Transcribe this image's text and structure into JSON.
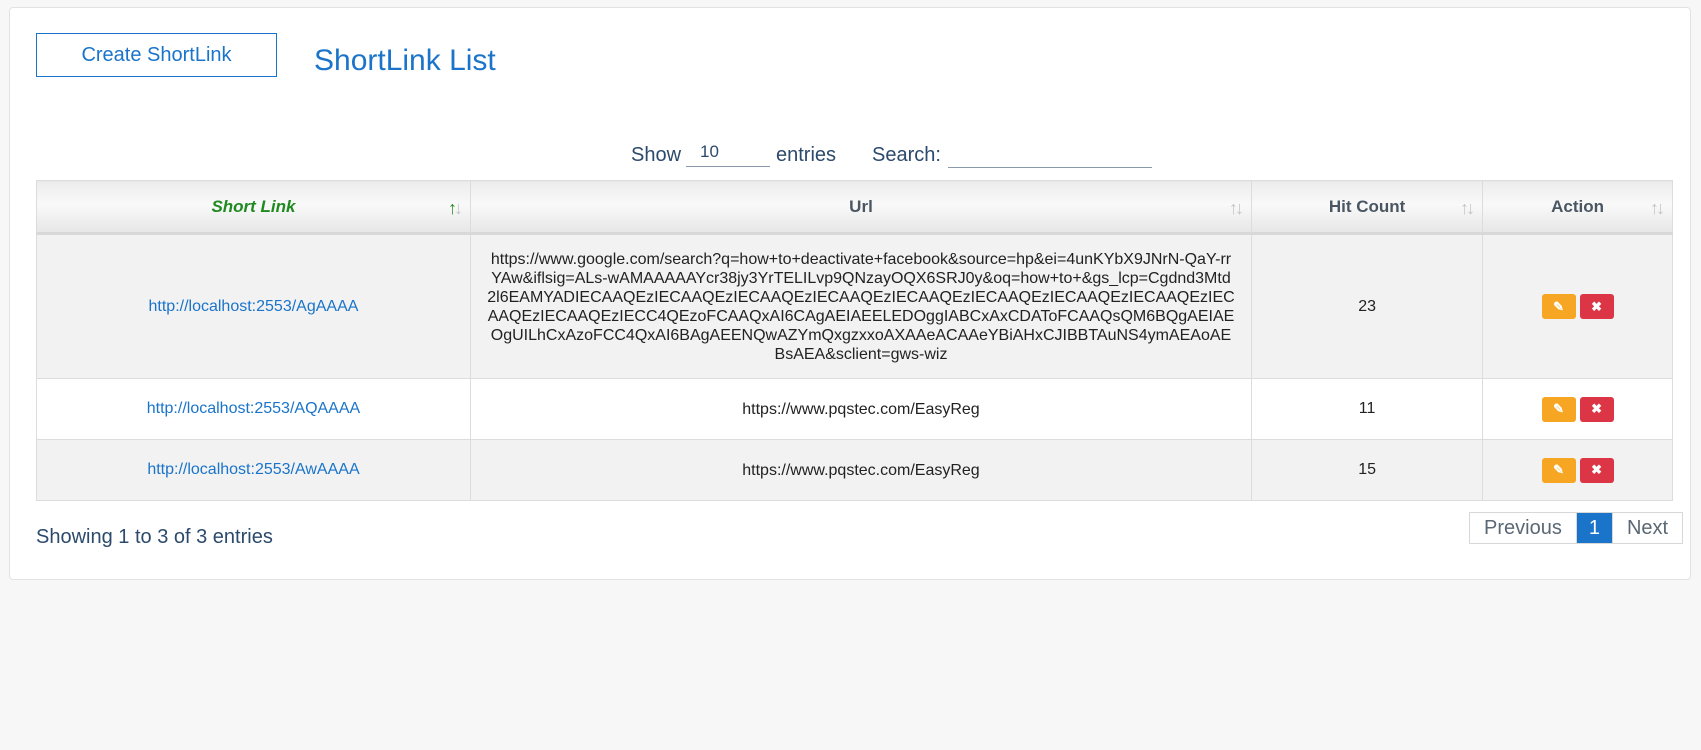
{
  "header": {
    "create_button": "Create ShortLink",
    "title": "ShortLink List"
  },
  "controls": {
    "show_label": "Show",
    "entries_value": "10",
    "entries_label": "entries",
    "search_label": "Search:",
    "search_value": ""
  },
  "table": {
    "columns": [
      "Short Link",
      "Url",
      "Hit Count",
      "Action"
    ],
    "rows": [
      {
        "short_link": "http://localhost:2553/AgAAAA",
        "url": "https://www.google.com/search?q=how+to+deactivate+facebook&source=hp&ei=4unKYbX9JNrN-QaY-rrYAw&iflsig=ALs-wAMAAAAAYcr38jy3YrTELILvp9QNzayOQX6SRJ0y&oq=how+to+&gs_lcp=Cgdnd3Mtd2l6EAMYADIECAAQEzIECAAQEzIECAAQEzIECAAQEzIECAAQEzIECAAQEzIECAAQEzIECAAQEzIECAAQEzIECAAQEzIECC4QEzoFCAAQxAI6CAgAEIAEELEDOggIABCxAxCDAToFCAAQsQM6BQgAEIAEOgUILhCxAzoFCC4QxAI6BAgAEENQwAZYmQxgzxxoAXAAeACAAeYBiAHxCJIBBTAuNS4ymAEAoAEBsAEA&sclient=gws-wiz",
        "hit_count": "23"
      },
      {
        "short_link": "http://localhost:2553/AQAAAA",
        "url": "https://www.pqstec.com/EasyReg",
        "hit_count": "11"
      },
      {
        "short_link": "http://localhost:2553/AwAAAA",
        "url": "https://www.pqstec.com/EasyReg",
        "hit_count": "15"
      }
    ]
  },
  "footer": {
    "status": "Showing 1 to 3 of 3 entries",
    "prev_label": "Previous",
    "current_page": "1",
    "next_label": "Next"
  },
  "icons": {
    "sort": "sort-arrows-icon",
    "edit": "edit-icon",
    "delete": "delete-icon"
  },
  "colors": {
    "accent": "#1a74c9",
    "active_sort": "#1f8a1f",
    "edit_button": "#f6a623",
    "delete_button": "#dc3545"
  }
}
